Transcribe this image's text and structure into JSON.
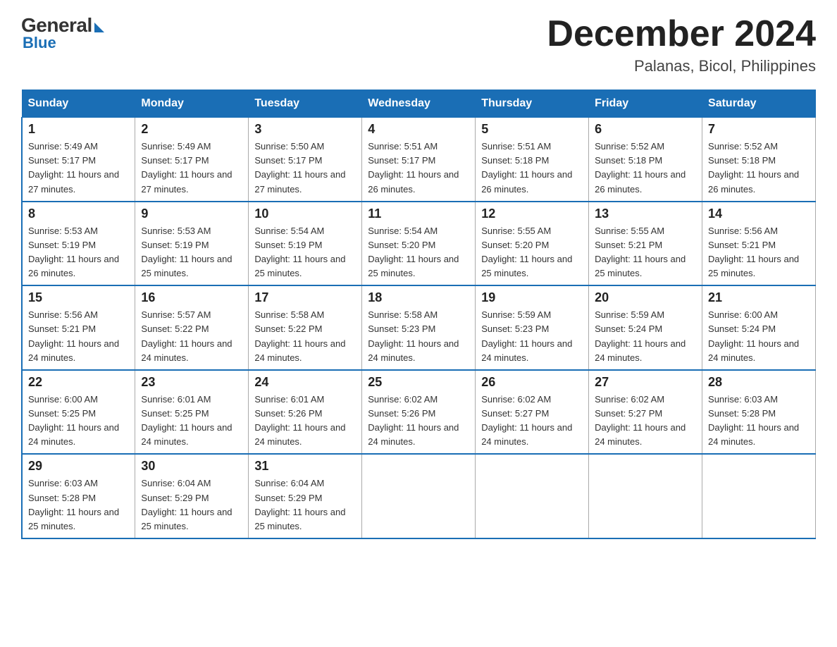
{
  "logo": {
    "general": "General",
    "blue": "Blue"
  },
  "header": {
    "month": "December 2024",
    "location": "Palanas, Bicol, Philippines"
  },
  "weekdays": [
    "Sunday",
    "Monday",
    "Tuesday",
    "Wednesday",
    "Thursday",
    "Friday",
    "Saturday"
  ],
  "weeks": [
    [
      {
        "day": "1",
        "sunrise": "5:49 AM",
        "sunset": "5:17 PM",
        "daylight": "11 hours and 27 minutes."
      },
      {
        "day": "2",
        "sunrise": "5:49 AM",
        "sunset": "5:17 PM",
        "daylight": "11 hours and 27 minutes."
      },
      {
        "day": "3",
        "sunrise": "5:50 AM",
        "sunset": "5:17 PM",
        "daylight": "11 hours and 27 minutes."
      },
      {
        "day": "4",
        "sunrise": "5:51 AM",
        "sunset": "5:17 PM",
        "daylight": "11 hours and 26 minutes."
      },
      {
        "day": "5",
        "sunrise": "5:51 AM",
        "sunset": "5:18 PM",
        "daylight": "11 hours and 26 minutes."
      },
      {
        "day": "6",
        "sunrise": "5:52 AM",
        "sunset": "5:18 PM",
        "daylight": "11 hours and 26 minutes."
      },
      {
        "day": "7",
        "sunrise": "5:52 AM",
        "sunset": "5:18 PM",
        "daylight": "11 hours and 26 minutes."
      }
    ],
    [
      {
        "day": "8",
        "sunrise": "5:53 AM",
        "sunset": "5:19 PM",
        "daylight": "11 hours and 26 minutes."
      },
      {
        "day": "9",
        "sunrise": "5:53 AM",
        "sunset": "5:19 PM",
        "daylight": "11 hours and 25 minutes."
      },
      {
        "day": "10",
        "sunrise": "5:54 AM",
        "sunset": "5:19 PM",
        "daylight": "11 hours and 25 minutes."
      },
      {
        "day": "11",
        "sunrise": "5:54 AM",
        "sunset": "5:20 PM",
        "daylight": "11 hours and 25 minutes."
      },
      {
        "day": "12",
        "sunrise": "5:55 AM",
        "sunset": "5:20 PM",
        "daylight": "11 hours and 25 minutes."
      },
      {
        "day": "13",
        "sunrise": "5:55 AM",
        "sunset": "5:21 PM",
        "daylight": "11 hours and 25 minutes."
      },
      {
        "day": "14",
        "sunrise": "5:56 AM",
        "sunset": "5:21 PM",
        "daylight": "11 hours and 25 minutes."
      }
    ],
    [
      {
        "day": "15",
        "sunrise": "5:56 AM",
        "sunset": "5:21 PM",
        "daylight": "11 hours and 24 minutes."
      },
      {
        "day": "16",
        "sunrise": "5:57 AM",
        "sunset": "5:22 PM",
        "daylight": "11 hours and 24 minutes."
      },
      {
        "day": "17",
        "sunrise": "5:58 AM",
        "sunset": "5:22 PM",
        "daylight": "11 hours and 24 minutes."
      },
      {
        "day": "18",
        "sunrise": "5:58 AM",
        "sunset": "5:23 PM",
        "daylight": "11 hours and 24 minutes."
      },
      {
        "day": "19",
        "sunrise": "5:59 AM",
        "sunset": "5:23 PM",
        "daylight": "11 hours and 24 minutes."
      },
      {
        "day": "20",
        "sunrise": "5:59 AM",
        "sunset": "5:24 PM",
        "daylight": "11 hours and 24 minutes."
      },
      {
        "day": "21",
        "sunrise": "6:00 AM",
        "sunset": "5:24 PM",
        "daylight": "11 hours and 24 minutes."
      }
    ],
    [
      {
        "day": "22",
        "sunrise": "6:00 AM",
        "sunset": "5:25 PM",
        "daylight": "11 hours and 24 minutes."
      },
      {
        "day": "23",
        "sunrise": "6:01 AM",
        "sunset": "5:25 PM",
        "daylight": "11 hours and 24 minutes."
      },
      {
        "day": "24",
        "sunrise": "6:01 AM",
        "sunset": "5:26 PM",
        "daylight": "11 hours and 24 minutes."
      },
      {
        "day": "25",
        "sunrise": "6:02 AM",
        "sunset": "5:26 PM",
        "daylight": "11 hours and 24 minutes."
      },
      {
        "day": "26",
        "sunrise": "6:02 AM",
        "sunset": "5:27 PM",
        "daylight": "11 hours and 24 minutes."
      },
      {
        "day": "27",
        "sunrise": "6:02 AM",
        "sunset": "5:27 PM",
        "daylight": "11 hours and 24 minutes."
      },
      {
        "day": "28",
        "sunrise": "6:03 AM",
        "sunset": "5:28 PM",
        "daylight": "11 hours and 24 minutes."
      }
    ],
    [
      {
        "day": "29",
        "sunrise": "6:03 AM",
        "sunset": "5:28 PM",
        "daylight": "11 hours and 25 minutes."
      },
      {
        "day": "30",
        "sunrise": "6:04 AM",
        "sunset": "5:29 PM",
        "daylight": "11 hours and 25 minutes."
      },
      {
        "day": "31",
        "sunrise": "6:04 AM",
        "sunset": "5:29 PM",
        "daylight": "11 hours and 25 minutes."
      },
      null,
      null,
      null,
      null
    ]
  ]
}
